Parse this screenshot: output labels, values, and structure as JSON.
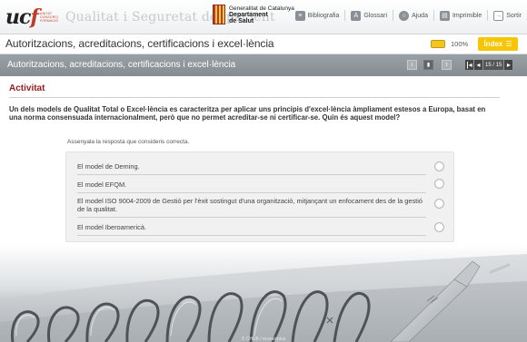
{
  "header": {
    "logo_text": "ucf",
    "logo_subtext": [
      "UNITAT",
      "CONSORCI",
      "FORMACIÓ"
    ],
    "app_title": "Qualitat i Seguretat del pacient",
    "gencat_line1": "Generalitat de Catalunya",
    "gencat_line2": "Departament",
    "gencat_line3": "de Salut",
    "links": {
      "bibliography": "Bibliografia",
      "glossary": "Glossari",
      "help": "Ajuda",
      "print": "Imprimible",
      "exit": "Sortir"
    }
  },
  "course": {
    "title": "Autoritzacions, acreditacions, certificacions i excel·lència",
    "progress_label": "100%",
    "progress_value": 1.0,
    "index_label": "Índex"
  },
  "section": {
    "title": "Autoritzacions, acreditacions, certificacions i excel·lència",
    "nav_icons": [
      "info-icon",
      "page-icon",
      "text-icon"
    ],
    "page_indicator": "15 / 15"
  },
  "activity": {
    "title": "Activitat",
    "question": "Un dels models de Qualitat Total o Excel·lència es caracteritza per aplicar uns principis d'excel·lència àmpliament estesos a Europa, basat en una norma consensuada internacionalment, però que no permet acreditar-se ni certificar-se. Quin és aquest model?",
    "instruction": "Assenyala la resposta que consideris correcta.",
    "answers": [
      "El model de Deming.",
      "El model EFQM.",
      "El model ISO 9004-2009 de Gestió per l'èxit sostingut d'una organització, mitjançant un enfocament des de la gestió de la qualitat.",
      "El model Iberoamericà."
    ]
  },
  "footer": {
    "credit": "© CHUB / mosaïcplus"
  },
  "colors": {
    "accent": "#9b1b1b",
    "index_button": "#f7c600",
    "section_bar": "#8f969b"
  }
}
